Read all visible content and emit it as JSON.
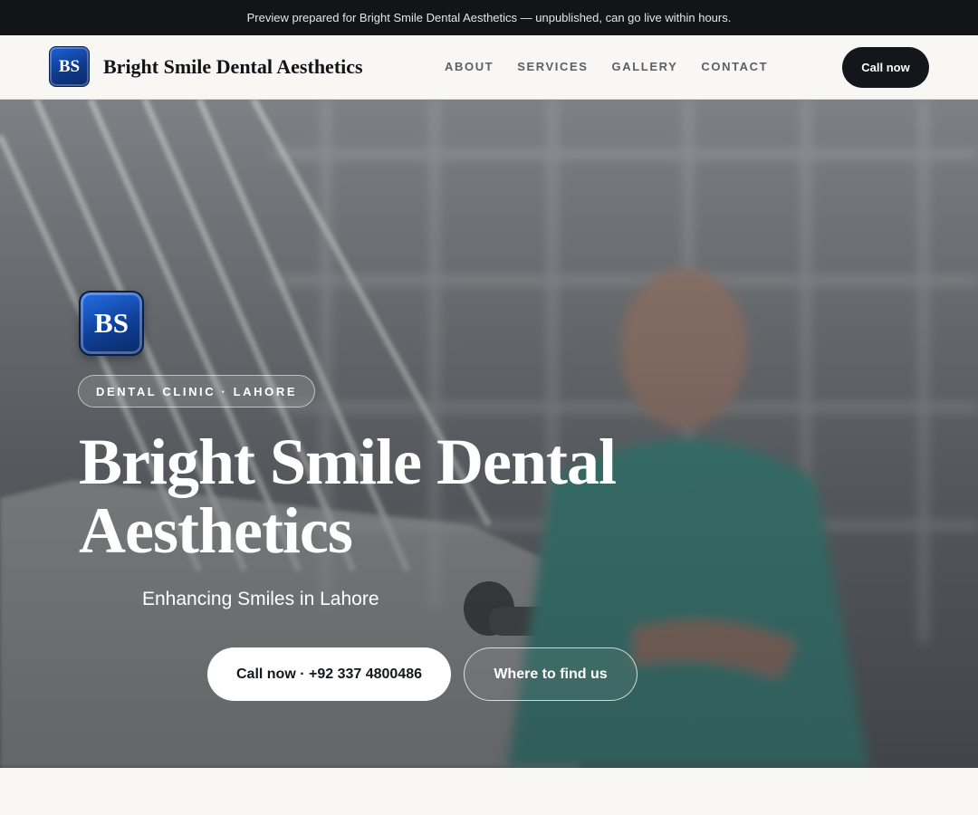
{
  "preview_bar": {
    "text": "Preview prepared for Bright Smile Dental Aesthetics — unpublished, can go live within hours."
  },
  "header": {
    "logo_initials": "BS",
    "brand_name": "Bright Smile Dental Aesthetics",
    "nav": [
      "ABOUT",
      "SERVICES",
      "GALLERY",
      "CONTACT"
    ],
    "cta_label": "Call now"
  },
  "hero": {
    "logo_initials": "BS",
    "badge": "DENTAL CLINIC · LAHORE",
    "title": "Bright Smile Dental Aesthetics",
    "subtitle": "Enhancing Smiles in Lahore",
    "primary_button": "Call now · +92 337 4800486",
    "secondary_button": "Where to find us",
    "background_image": "dentist-in-clinic-photo"
  },
  "colors": {
    "topbar_bg": "#121418",
    "header_bg": "#f8f7f4",
    "brand_blue": "#1d63d6",
    "dark_button": "#14161b"
  }
}
